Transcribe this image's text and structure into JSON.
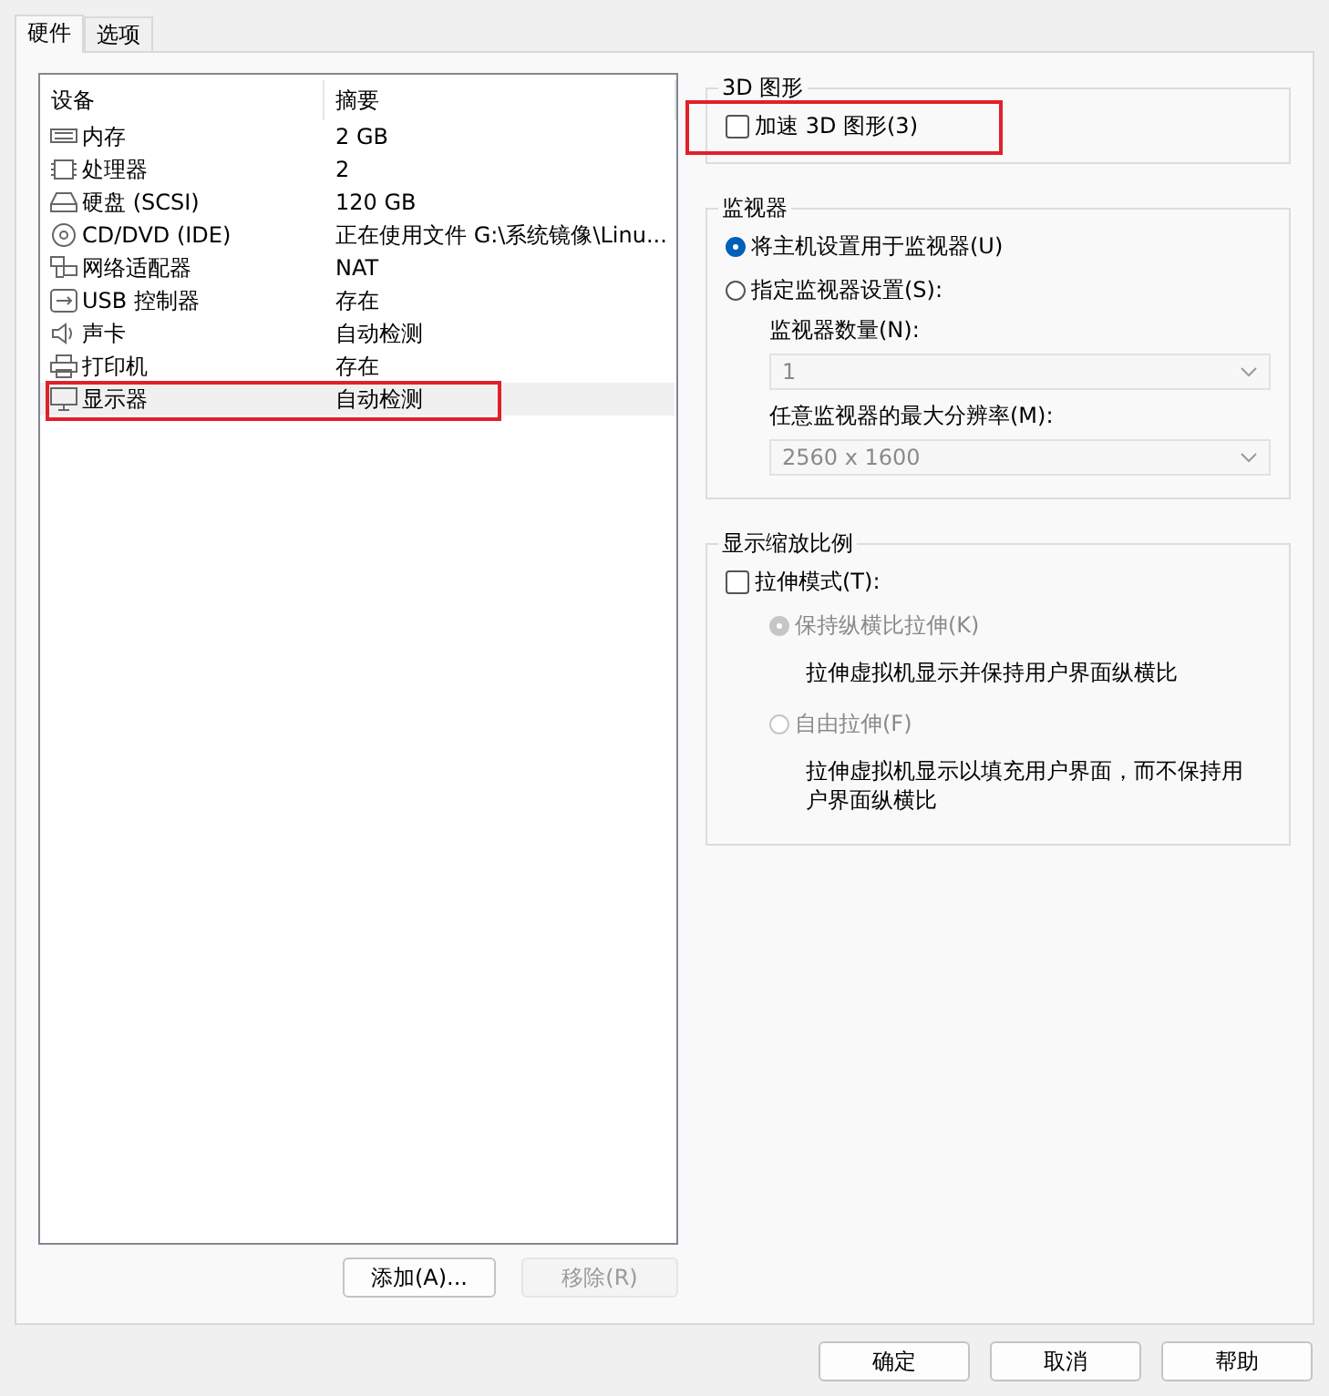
{
  "tabs": [
    {
      "label": "硬件",
      "selected": true
    },
    {
      "label": "选项",
      "selected": false
    }
  ],
  "device_list": {
    "columns": [
      "设备",
      "摘要"
    ],
    "rows": [
      {
        "kind": "memory",
        "device": "内存",
        "summary": "2 GB",
        "selected": false,
        "highlighted": false
      },
      {
        "kind": "cpu",
        "device": "处理器",
        "summary": "2",
        "selected": false,
        "highlighted": false
      },
      {
        "kind": "disk",
        "device": "硬盘 (SCSI)",
        "summary": "120 GB",
        "selected": false,
        "highlighted": false
      },
      {
        "kind": "cd",
        "device": "CD/DVD (IDE)",
        "summary": "正在使用文件 G:\\系统镜像\\Linu...",
        "selected": false,
        "highlighted": false
      },
      {
        "kind": "network",
        "device": "网络适配器",
        "summary": "NAT",
        "selected": false,
        "highlighted": false
      },
      {
        "kind": "usb",
        "device": "USB 控制器",
        "summary": "存在",
        "selected": false,
        "highlighted": false
      },
      {
        "kind": "sound",
        "device": "声卡",
        "summary": "自动检测",
        "selected": false,
        "highlighted": false
      },
      {
        "kind": "printer",
        "device": "打印机",
        "summary": "存在",
        "selected": false,
        "highlighted": false
      },
      {
        "kind": "display",
        "device": "显示器",
        "summary": "自动检测",
        "selected": true,
        "highlighted": true
      }
    ]
  },
  "list_buttons": [
    {
      "label": "添加(A)...",
      "disabled": false
    },
    {
      "label": "移除(R)",
      "disabled": true
    }
  ],
  "graphics_group": {
    "title": "3D 图形",
    "accelerate": {
      "label": "加速 3D 图形(3)",
      "checked": false,
      "highlighted": true
    }
  },
  "monitor_group": {
    "title": "监视器",
    "options": [
      {
        "label": "将主机设置用于监视器(U)",
        "selected": true
      },
      {
        "label": "指定监视器设置(S):",
        "selected": false
      }
    ],
    "fields": [
      {
        "label": "监视器数量(N):",
        "value": "1",
        "disabled": true
      },
      {
        "label": "任意监视器的最大分辨率(M):",
        "value": "2560 x 1600",
        "disabled": true
      }
    ]
  },
  "scaling_group": {
    "title": "显示缩放比例",
    "stretch": {
      "label": "拉伸模式(T):",
      "checked": false
    },
    "options": [
      {
        "label": "保持纵横比拉伸(K)",
        "selected": true,
        "disabled": true,
        "description": "拉伸虚拟机显示并保持用户界面纵横比"
      },
      {
        "label": "自由拉伸(F)",
        "selected": false,
        "disabled": true,
        "description": "拉伸虚拟机显示以填充用户界面，而不保持用户界面纵横比"
      }
    ]
  },
  "footer_buttons": [
    "确定",
    "取消",
    "帮助"
  ]
}
